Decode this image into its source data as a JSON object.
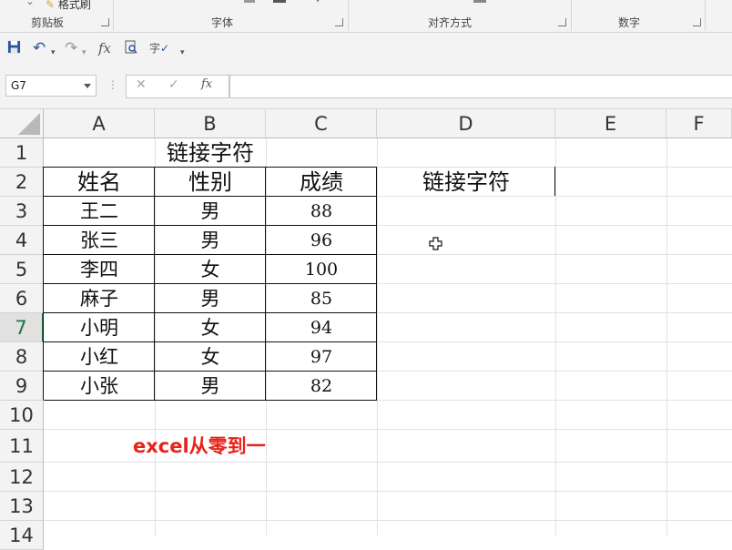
{
  "ribbon": {
    "groups": [
      {
        "label": "剪贴板"
      },
      {
        "label": "字体"
      },
      {
        "label": "对齐方式"
      },
      {
        "label": "数字"
      }
    ],
    "format_painter_label": "格式刷"
  },
  "qat": {
    "save_icon": "save-icon",
    "undo_icon": "undo-icon",
    "redo_icon": "redo-icon",
    "fx_icon": "function-icon",
    "preview_icon": "print-preview-icon",
    "spell_icon": "spellcheck-icon",
    "more_icon": "customize-qat-icon"
  },
  "formula_bar": {
    "name_box": "G7",
    "cancel_glyph": "✕",
    "enter_glyph": "✓",
    "fx_glyph": "fx",
    "formula": ""
  },
  "columns": [
    "A",
    "B",
    "C",
    "D",
    "E",
    "F"
  ],
  "rows": [
    "1",
    "2",
    "3",
    "4",
    "5",
    "6",
    "7",
    "8",
    "9",
    "10",
    "11",
    "12",
    "13",
    "14"
  ],
  "selected_row": "7",
  "sheet": {
    "title": "链接字符",
    "headers": [
      "姓名",
      "性别",
      "成绩"
    ],
    "d2": "链接字符",
    "records": [
      {
        "name": "王二",
        "gender": "男",
        "score": "88"
      },
      {
        "name": "张三",
        "gender": "男",
        "score": "96"
      },
      {
        "name": "李四",
        "gender": "女",
        "score": "100"
      },
      {
        "name": "麻子",
        "gender": "男",
        "score": "85"
      },
      {
        "name": "小明",
        "gender": "女",
        "score": "94"
      },
      {
        "name": "小红",
        "gender": "女",
        "score": "97"
      },
      {
        "name": "小张",
        "gender": "男",
        "score": "82"
      }
    ],
    "watermark": "excel从零到一",
    "watermark_color": "#e8231a"
  },
  "colors": {
    "accent": "#217346",
    "qat_icon": "#2b579a"
  }
}
